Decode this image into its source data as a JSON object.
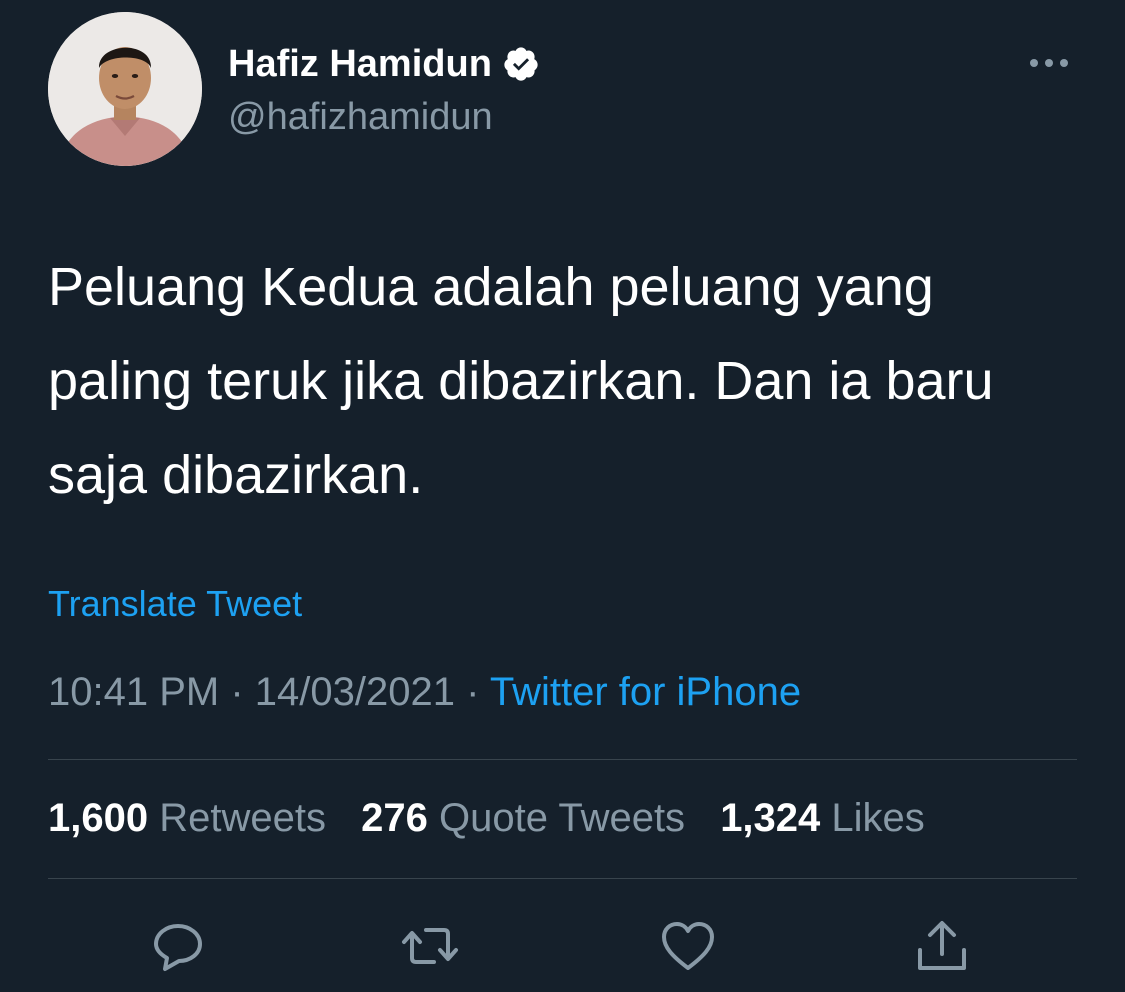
{
  "author": {
    "display_name": "Hafiz Hamidun",
    "handle": "@hafizhamidun",
    "verified": true,
    "avatar_icon": "profile-photo"
  },
  "tweet": {
    "text": "Peluang Kedua adalah peluang yang paling teruk jika dibazirkan. Dan ia baru saja dibazirkan.",
    "translate_label": "Translate Tweet",
    "time": "10:41 PM",
    "separator": "·",
    "date": "14/03/2021",
    "source": "Twitter for iPhone"
  },
  "stats": {
    "retweets_count": "1,600",
    "retweets_label": "Retweets",
    "quotes_count": "276",
    "quotes_label": "Quote Tweets",
    "likes_count": "1,324",
    "likes_label": "Likes"
  },
  "actions": [
    "reply-icon",
    "retweet-icon",
    "like-icon",
    "share-icon"
  ],
  "colors": {
    "background": "#15202b",
    "text": "#ffffff",
    "secondary_text": "#8899a6",
    "accent": "#1da1f2",
    "divider": "#38444d"
  }
}
